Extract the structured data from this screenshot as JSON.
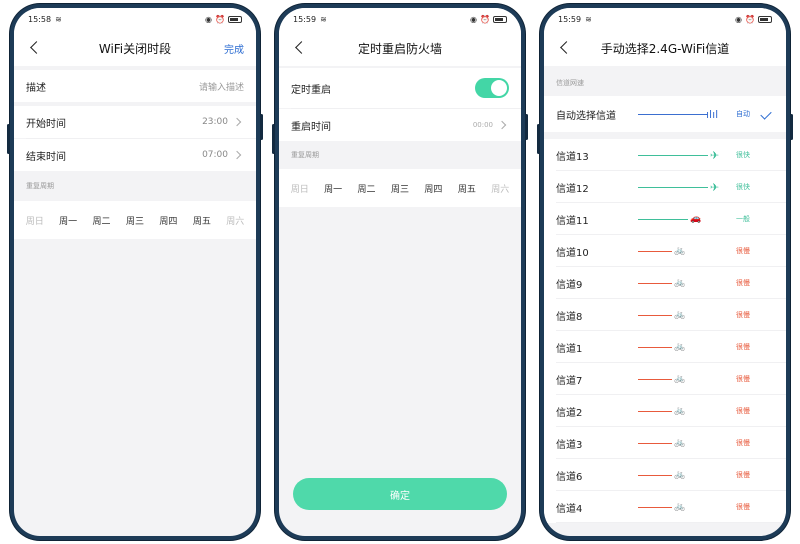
{
  "colors": {
    "accent_blue": "#2a6bd1",
    "green": "#43d6a6",
    "teal": "#3fbf9a",
    "red": "#e85a3c",
    "blue_bar": "#3b6fd0"
  },
  "screen1": {
    "status_time": "15:58",
    "title": "WiFi关闭时段",
    "action": "完成",
    "desc_label": "描述",
    "desc_placeholder": "请输入描述",
    "start_label": "开始时间",
    "start_value": "23:00",
    "end_label": "结束时间",
    "end_value": "07:00",
    "repeat_label": "重复周期",
    "weekdays": [
      "周日",
      "周一",
      "周二",
      "周三",
      "周四",
      "周五",
      "周六"
    ]
  },
  "screen2": {
    "status_time": "15:59",
    "title": "定时重启防火墙",
    "reboot_label": "定时重启",
    "reboot_enabled": true,
    "reboot_time_label": "重启时间",
    "reboot_time_value": "00:00",
    "repeat_label": "重复周期",
    "weekdays": [
      "周日",
      "周一",
      "周二",
      "周三",
      "周四",
      "周五",
      "周六"
    ],
    "confirm": "确定"
  },
  "screen3": {
    "status_time": "15:59",
    "title": "手动选择2.4G-WiFi信道",
    "section_label": "信道网速",
    "auto": {
      "name": "自动选择信道",
      "speed": "自动",
      "icon": "signal-icon"
    },
    "channels": [
      {
        "name": "信道13",
        "speed": "很快",
        "icon": "airplane-icon",
        "level": "fast"
      },
      {
        "name": "信道12",
        "speed": "很快",
        "icon": "airplane-icon",
        "level": "fast"
      },
      {
        "name": "信道11",
        "speed": "一般",
        "icon": "car-icon",
        "level": "normal"
      },
      {
        "name": "信道10",
        "speed": "很慢",
        "icon": "bicycle-icon",
        "level": "slow"
      },
      {
        "name": "信道9",
        "speed": "很慢",
        "icon": "bicycle-icon",
        "level": "slow"
      },
      {
        "name": "信道8",
        "speed": "很慢",
        "icon": "bicycle-icon",
        "level": "slow"
      },
      {
        "name": "信道1",
        "speed": "很慢",
        "icon": "bicycle-icon",
        "level": "slow"
      },
      {
        "name": "信道7",
        "speed": "很慢",
        "icon": "bicycle-icon",
        "level": "slow"
      },
      {
        "name": "信道2",
        "speed": "很慢",
        "icon": "bicycle-icon",
        "level": "slow"
      },
      {
        "name": "信道3",
        "speed": "很慢",
        "icon": "bicycle-icon",
        "level": "slow"
      },
      {
        "name": "信道6",
        "speed": "很慢",
        "icon": "bicycle-icon",
        "level": "slow"
      },
      {
        "name": "信道4",
        "speed": "很慢",
        "icon": "bicycle-icon",
        "level": "slow"
      }
    ]
  }
}
